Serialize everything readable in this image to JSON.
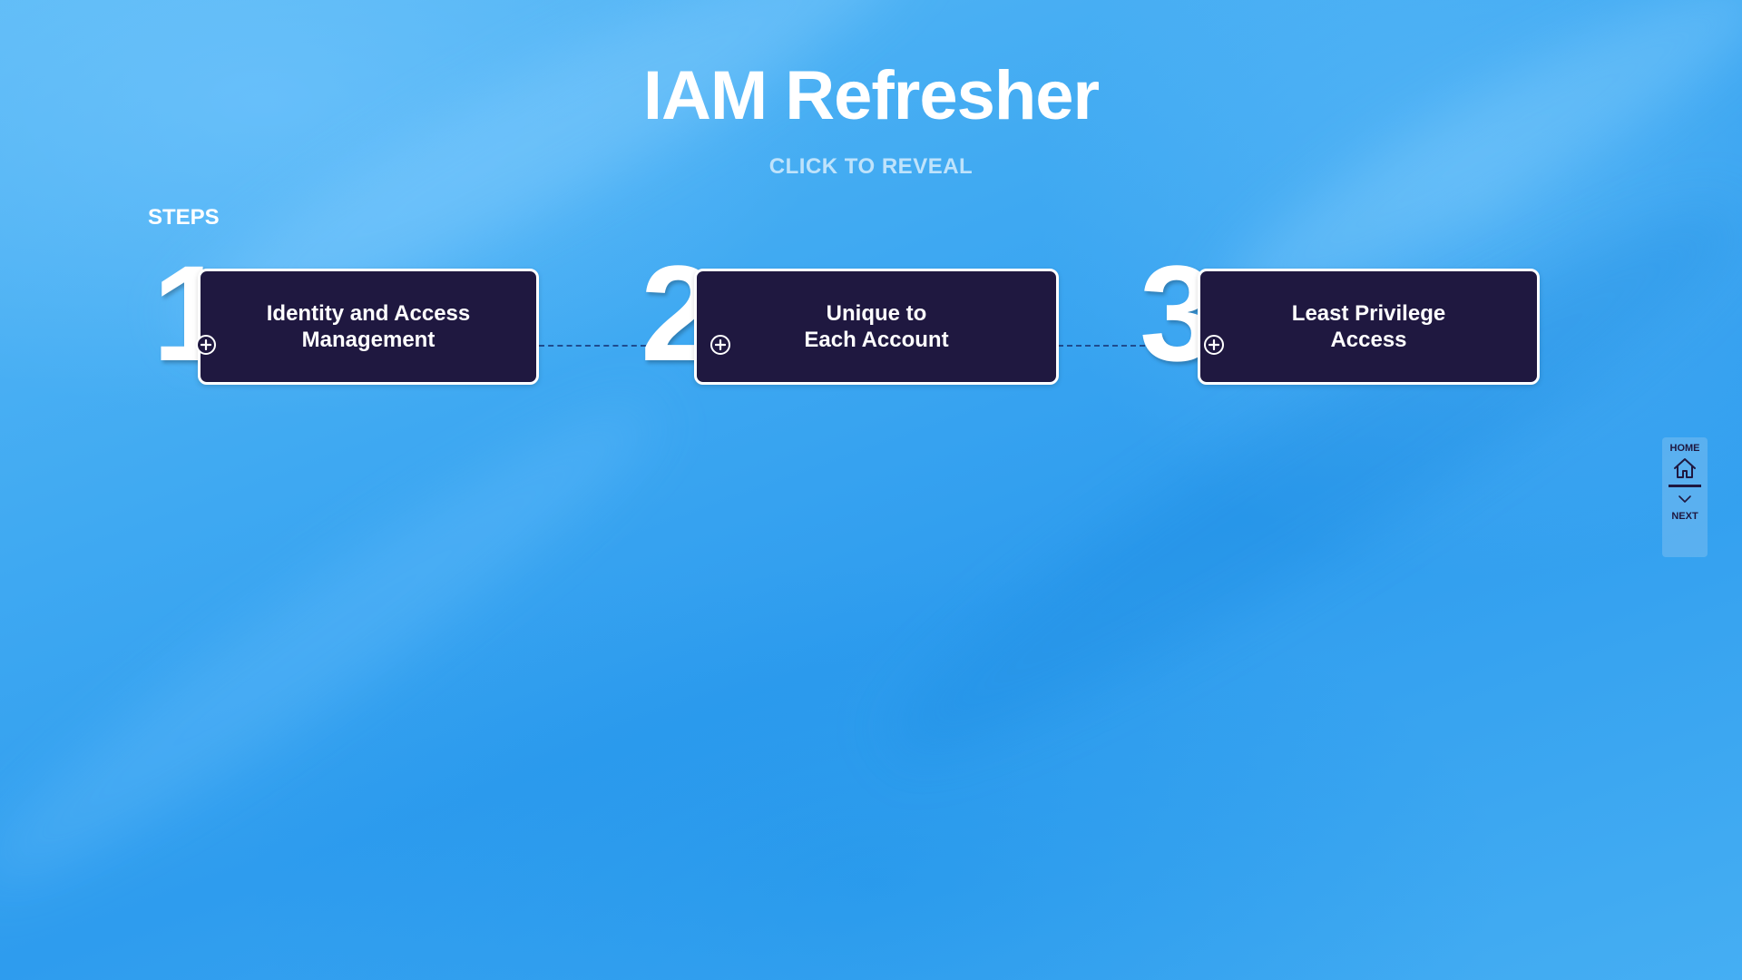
{
  "page": {
    "title": "IAM Refresher",
    "subtitle": "CLICK TO REVEAL",
    "steps_label": "STEPS"
  },
  "steps": [
    {
      "number": "1",
      "line1": "Identity and Access",
      "line2": "Management"
    },
    {
      "number": "2",
      "line1": "Unique to",
      "line2": "Each Account"
    },
    {
      "number": "3",
      "line1": "Least Privilege",
      "line2": "Access"
    }
  ],
  "nav": {
    "home_label": "HOME",
    "next_label": "NEXT"
  },
  "icons": {
    "expand": "plus-icon",
    "home": "home-icon",
    "next": "chevron-down-icon"
  },
  "colors": {
    "card_bg": "#1f1840",
    "card_border": "#ffffff",
    "background": "#3aa7f0",
    "connector": "#1f4c8e"
  }
}
